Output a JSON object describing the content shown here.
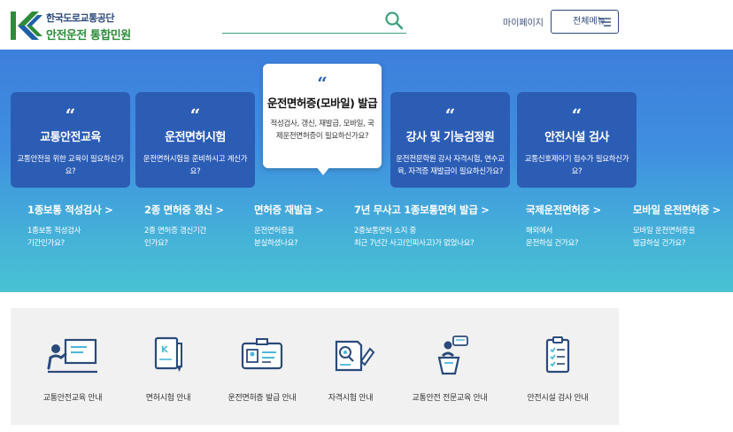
{
  "header": {
    "logo_line1": "한국도로교통공단",
    "logo_line2": "안전운전 통합민원",
    "search": {
      "icon": "search-icon",
      "placeholder": ""
    },
    "mypage_label": "마이페이지",
    "allmenu_label": "전체메뉴"
  },
  "hero": {
    "cards": [
      {
        "quote": "“",
        "title": "교통안전교육",
        "desc": "교통안전을 위한 교육이 필요하신가요?"
      },
      {
        "quote": "“",
        "title": "운전면허시험",
        "desc": "운전면허시험을 준비하시고 계신가요?"
      },
      {
        "quote": "“",
        "title": "운전면허증(모바일) 발급",
        "desc": "적성검사, 갱신, 재발급, 모바일, 국제운전면허증이 필요하신가요?"
      },
      {
        "quote": "“",
        "title": "강사 및 기능검정원",
        "desc": "운전전문학원 강사 자격시험, 연수교육, 자격증 재발급이 필요하신가요?"
      },
      {
        "quote": "“",
        "title": "안전시설 검사",
        "desc": "교통신호제어기 접수가 필요하신가요?"
      }
    ],
    "links": [
      {
        "label": "1종보통 적성검사 >",
        "desc": "1종보통 적성검사\n기간인가요?"
      },
      {
        "label": "2종 면허증 갱신 >",
        "desc": "2종 면허증 갱신기간\n인가요?"
      },
      {
        "label": "면허증 재발급 >",
        "desc": "운전면허증을\n분실하셨나요?"
      },
      {
        "label": "7년 무사고 1종보통면허 발급 >",
        "desc": "2종보통면허 소지 중\n최근 7년간 사고(인피사고)가 없었나요?"
      },
      {
        "label": "국제운전면허증 >",
        "desc": "해외에서\n운전하실 건가요?"
      },
      {
        "label": "모바일 운전면허증 >",
        "desc": "모바일 운전면허증을\n발급하실 건가요?"
      }
    ]
  },
  "services": [
    {
      "icon": "instructor-board-icon",
      "label": "교통안전교육 안내"
    },
    {
      "icon": "license-book-pen-icon",
      "label": "면허시험 안내"
    },
    {
      "icon": "id-card-icon",
      "label": "운전면허증 발급 안내"
    },
    {
      "icon": "exam-search-pen-icon",
      "label": "자격시험 안내"
    },
    {
      "icon": "lecturer-podium-icon",
      "label": "교통안전 전문교육 안내"
    },
    {
      "icon": "clipboard-checklist-icon",
      "label": "안전시설 검사 안내"
    }
  ],
  "colors": {
    "brand_navy": "#2b4a7a",
    "brand_green": "#2e8b3a",
    "card_blue": "#2c5db5",
    "hero_top": "#3d7fdc",
    "hero_bottom": "#49c2d2",
    "search_line": "#3aa27a"
  }
}
